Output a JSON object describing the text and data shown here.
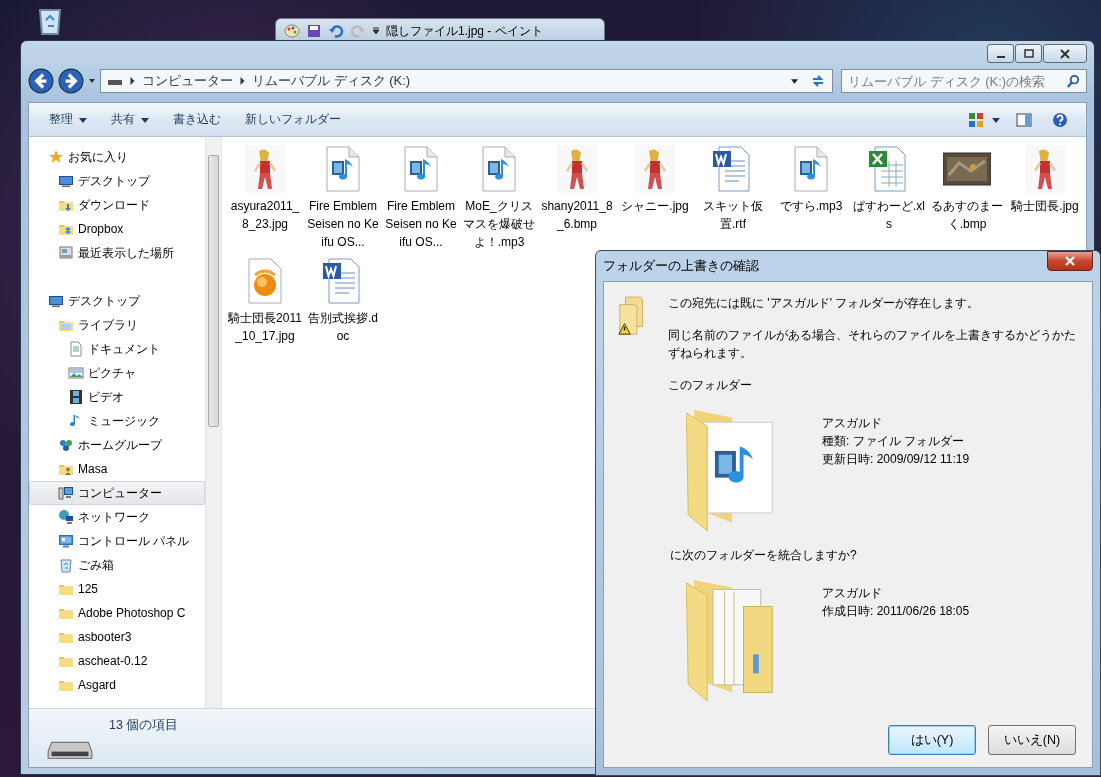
{
  "paint_window": {
    "title": "隠しファイル1.jpg - ペイント"
  },
  "explorer": {
    "breadcrumb": [
      "コンピューター",
      "リムーバブル ディスク (K:)"
    ],
    "search": {
      "placeholder": "リムーバブル ディスク (K:)の検索"
    },
    "toolbar": [
      {
        "label": "整理",
        "menu": true
      },
      {
        "label": "共有",
        "menu": true
      },
      {
        "label": "書き込む",
        "menu": false
      },
      {
        "label": "新しいフォルダー",
        "menu": false
      }
    ],
    "navigation": [
      {
        "label": "お気に入り",
        "kind": "star",
        "selected": false,
        "children": [
          {
            "label": "デスクトップ",
            "kind": "desktop",
            "selected": false
          },
          {
            "label": "ダウンロード",
            "kind": "download",
            "selected": false
          },
          {
            "label": "Dropbox",
            "kind": "dropbox",
            "selected": false
          },
          {
            "label": "最近表示した場所",
            "kind": "recent",
            "selected": false
          }
        ]
      },
      {
        "label": "デスクトップ",
        "kind": "desktop",
        "selected": false,
        "children": [
          {
            "label": "ライブラリ",
            "kind": "library",
            "selected": false,
            "children": [
              {
                "label": "ドキュメント",
                "kind": "document",
                "selected": false
              },
              {
                "label": "ピクチャ",
                "kind": "pictures",
                "selected": false
              },
              {
                "label": "ビデオ",
                "kind": "video",
                "selected": false
              },
              {
                "label": "ミュージック",
                "kind": "music",
                "selected": false
              }
            ]
          },
          {
            "label": "ホームグループ",
            "kind": "homegroup",
            "selected": false
          },
          {
            "label": "Masa",
            "kind": "user",
            "selected": false
          },
          {
            "label": "コンピューター",
            "kind": "computer",
            "selected": true
          },
          {
            "label": "ネットワーク",
            "kind": "network",
            "selected": false
          },
          {
            "label": "コントロール パネル",
            "kind": "control",
            "selected": false
          },
          {
            "label": "ごみ箱",
            "kind": "recycle",
            "selected": false
          },
          {
            "label": "125",
            "kind": "folder",
            "selected": false
          },
          {
            "label": "Adobe Photoshop C",
            "kind": "folder",
            "selected": false
          },
          {
            "label": "asbooter3",
            "kind": "folder",
            "selected": false
          },
          {
            "label": "ascheat-0.12",
            "kind": "folder",
            "selected": false
          },
          {
            "label": "Asgard",
            "kind": "folder",
            "selected": false
          }
        ]
      }
    ],
    "files": [
      {
        "name": "asyura2011_8_23.jpg",
        "kind": "figure"
      },
      {
        "name": "Fire Emblem Seisen no Keifu OS...",
        "kind": "media"
      },
      {
        "name": "Fire Emblem Seisen no Keifu OS...",
        "kind": "media"
      },
      {
        "name": "MoE_クリスマスを爆破せよ！.mp3",
        "kind": "media"
      },
      {
        "name": "shany2011_8_6.bmp",
        "kind": "figure"
      },
      {
        "name": "シャニー.jpg",
        "kind": "figure"
      },
      {
        "name": "スキット仮置.rtf",
        "kind": "word"
      },
      {
        "name": "ですら.mp3",
        "kind": "media"
      },
      {
        "name": "ぱすわーど.xls",
        "kind": "excel"
      },
      {
        "name": "るあすのまーく.bmp",
        "kind": "map"
      },
      {
        "name": "騎士団長.jpg",
        "kind": "figure"
      },
      {
        "name": "騎士団長2011_10_17.jpg",
        "kind": "player"
      },
      {
        "name": "告別式挨拶.doc",
        "kind": "word"
      }
    ],
    "status": "13 個の項目"
  },
  "dialog": {
    "title": "フォルダーの上書きの確認",
    "message": "この宛先には既に 'アスガルド' フォルダーが存在します。",
    "detail": "同じ名前のファイルがある場合、それらのファイルを上書きするかどうかたずねられます。",
    "existing_heading": "このフォルダー",
    "existing": {
      "name": "アスガルド",
      "lines": [
        "種類: ファイル フォルダー",
        "更新日時: 2009/09/12 11:19"
      ]
    },
    "incoming_heading": "に次のフォルダーを統合しますか?",
    "incoming": {
      "name": "アスガルド",
      "lines": [
        "作成日時: 2011/06/26 18:05"
      ]
    },
    "buttons": [
      {
        "label": "はい(Y)",
        "default": true
      },
      {
        "label": "いいえ(N)",
        "default": false
      }
    ]
  }
}
